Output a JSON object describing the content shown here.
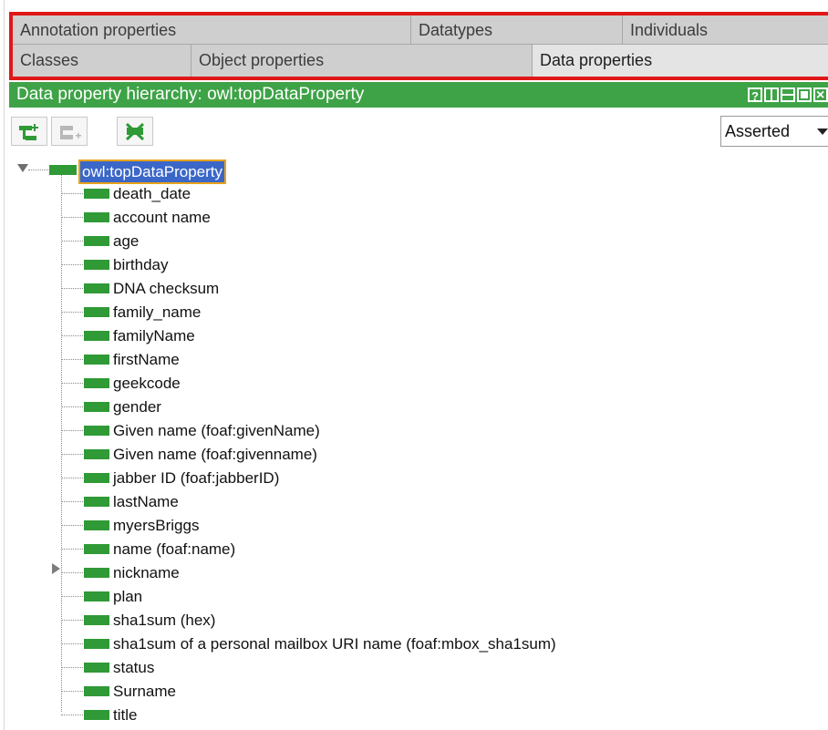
{
  "tabs": {
    "row1": [
      {
        "label": "Annotation properties"
      },
      {
        "label": "Datatypes"
      },
      {
        "label": "Individuals"
      }
    ],
    "row2": [
      {
        "label": "Classes"
      },
      {
        "label": "Object properties"
      },
      {
        "label": "Data properties",
        "selected": true
      }
    ]
  },
  "panel": {
    "title": "Data property hierarchy: owl:topDataProperty",
    "title_buttons": [
      "help-icon",
      "split-vertical-icon",
      "split-horizontal-icon",
      "maximize-icon",
      "close-icon"
    ]
  },
  "toolbar": {
    "buttons": [
      "add-subproperty-icon",
      "add-sibling-property-icon",
      "delete-property-icon"
    ],
    "view_mode": "Asserted"
  },
  "tree": {
    "root": "owl:topDataProperty",
    "children": [
      {
        "label": "death_date"
      },
      {
        "label": "account name"
      },
      {
        "label": "age"
      },
      {
        "label": "birthday"
      },
      {
        "label": "DNA checksum"
      },
      {
        "label": "family_name"
      },
      {
        "label": "familyName"
      },
      {
        "label": "firstName"
      },
      {
        "label": "geekcode"
      },
      {
        "label": "gender"
      },
      {
        "label": "Given name (foaf:givenName)"
      },
      {
        "label": "Given name (foaf:givenname)"
      },
      {
        "label": "jabber ID (foaf:jabberID)"
      },
      {
        "label": "lastName"
      },
      {
        "label": "myersBriggs"
      },
      {
        "label": "name (foaf:name)"
      },
      {
        "label": "nickname",
        "expandable": true
      },
      {
        "label": "plan"
      },
      {
        "label": "sha1sum (hex)"
      },
      {
        "label": "sha1sum of a personal mailbox URI name (foaf:mbox_sha1sum)"
      },
      {
        "label": "status"
      },
      {
        "label": "Surname"
      },
      {
        "label": "title"
      }
    ]
  },
  "colors": {
    "accent_green": "#3ea347",
    "selection_blue": "#3b67c8",
    "highlight_red": "#e01818"
  }
}
